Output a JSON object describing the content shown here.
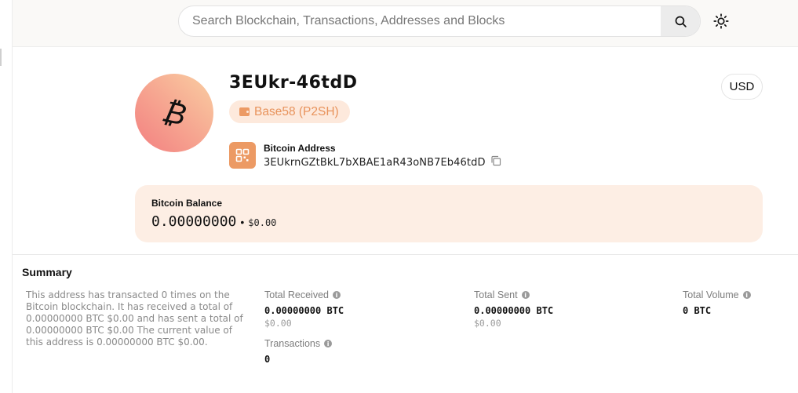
{
  "search": {
    "placeholder": "Search Blockchain, Transactions, Addresses and Blocks",
    "icon": "search-icon"
  },
  "theme_toggle": {
    "icon": "sun-icon"
  },
  "address": {
    "short": "3EUkr-46tdD",
    "type_label": "Base58 (P2SH)",
    "type_icon": "wallet-icon",
    "coin_icon": "bitcoin-icon",
    "coin_symbol": "₿",
    "label": "Bitcoin Address",
    "full": "3EUkrnGZtBkL7bXBAE1aR43oNB7Eb46tdD",
    "qr_icon": "qr-code-icon",
    "copy_icon": "copy-icon"
  },
  "currency": {
    "label": "USD"
  },
  "balance": {
    "label": "Bitcoin Balance",
    "btc": "0.00000000",
    "separator": "•",
    "usd": "$0.00"
  },
  "summary": {
    "title": "Summary",
    "text": "This address has transacted 0 times on the Bitcoin blockchain. It has received a total of 0.00000000 BTC $0.00 and has sent a total of 0.00000000 BTC $0.00 The current value of this address is 0.00000000 BTC $0.00."
  },
  "stats": {
    "total_received": {
      "label": "Total Received",
      "value": "0.00000000 BTC",
      "sub": "$0.00"
    },
    "total_sent": {
      "label": "Total Sent",
      "value": "0.00000000 BTC",
      "sub": "$0.00"
    },
    "total_volume": {
      "label": "Total Volume",
      "value": "0 BTC"
    },
    "transactions": {
      "label": "Transactions",
      "value": "0"
    }
  },
  "colors": {
    "accent": "#ec9a64",
    "badge_bg": "#fde9dc",
    "balance_bg": "#fdeee4",
    "topbar_bg": "#faf9f7"
  }
}
